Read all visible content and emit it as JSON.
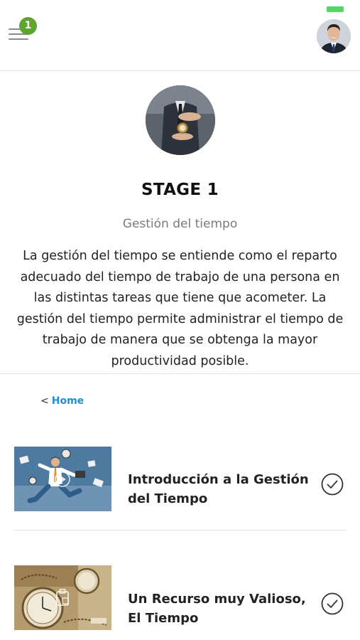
{
  "header": {
    "menu_icon": "hamburger-menu-icon",
    "notification_count": "1",
    "status_color": "#4cd964",
    "badge_color": "#5da52f"
  },
  "stage": {
    "title": "STAGE 1",
    "subtitle": "Gestión del tiempo",
    "description": "La gestión del tiempo se entiende como el reparto adecuado del tiempo de trabajo de una persona en las distintas tareas que tiene que acometer. La gestión del tiempo permite administrar el tiempo de trabajo de manera que se obtenga la mayor productividad posible."
  },
  "breadcrumb": {
    "chevron": "<",
    "home_label": "Home",
    "link_color": "#1e8fd6"
  },
  "lessons": [
    {
      "title_line1": "Introducción a la Gestión",
      "title_line2": "del Tiempo",
      "type_icon": "play-icon",
      "status_icon": "check-circle-icon"
    },
    {
      "title_line1": "Un Recurso muy Valioso,",
      "title_line2": "El Tiempo",
      "type_icon": "clipboard-icon",
      "status_icon": "check-circle-icon"
    }
  ]
}
